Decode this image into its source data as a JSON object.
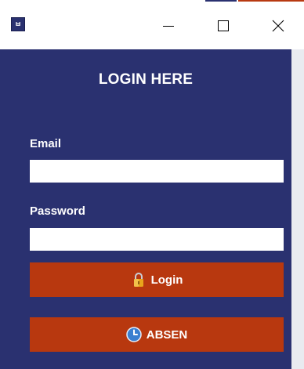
{
  "window": {
    "icon": "app-icon",
    "icon_text": "ㅂ",
    "controls": {
      "minimize": "minimize-icon",
      "maximize": "maximize-icon",
      "close": "close-icon"
    }
  },
  "form": {
    "heading": "LOGIN HERE",
    "email_label": "Email",
    "email_value": "",
    "password_label": "Password",
    "password_value": "",
    "login_label": "Login",
    "login_icon": "lock-icon",
    "absen_label": "ABSEN",
    "absen_icon": "clock-icon"
  },
  "colors": {
    "background": "#2a3170",
    "button": "#b8380f",
    "text": "#ffffff"
  }
}
